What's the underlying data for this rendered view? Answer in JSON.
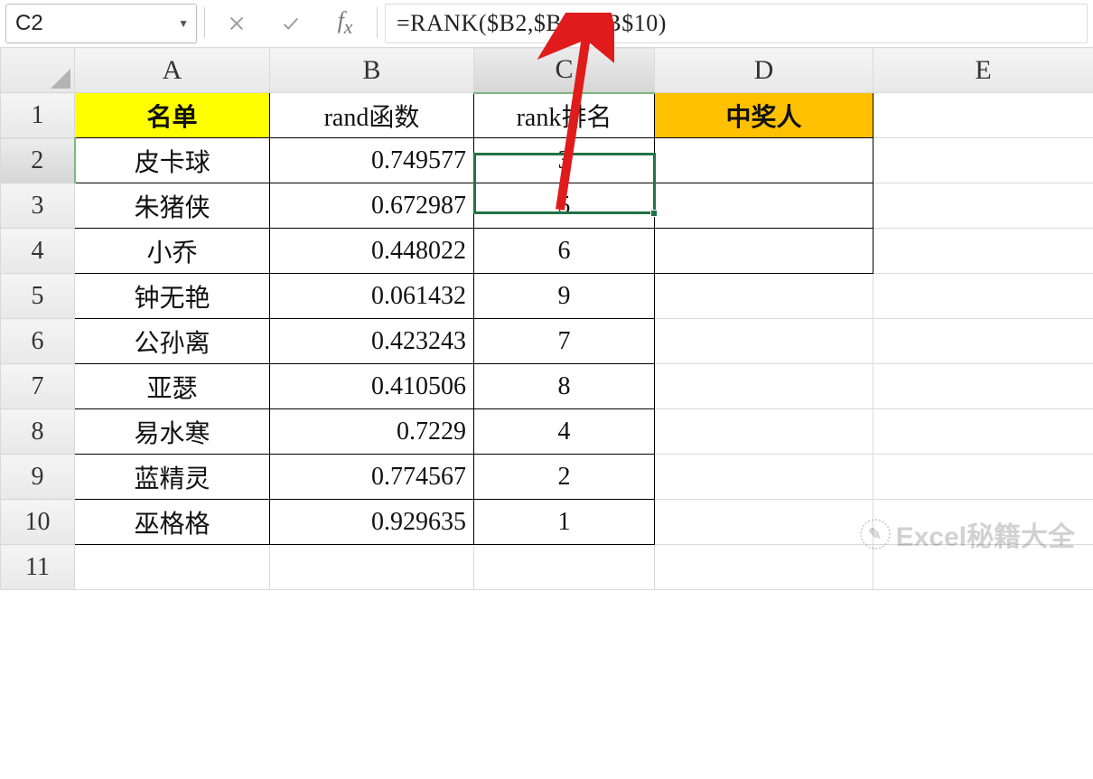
{
  "name_box": "C2",
  "formula": "=RANK($B2,$B$2:$B$10)",
  "columns": [
    "A",
    "B",
    "C",
    "D",
    "E"
  ],
  "row_numbers": [
    1,
    2,
    3,
    4,
    5,
    6,
    7,
    8,
    9,
    10,
    11
  ],
  "selected_col_index": 2,
  "selected_row_index": 1,
  "headers": {
    "A": "名单",
    "B": "rand函数",
    "C": "rank排名",
    "D": "中奖人"
  },
  "data_rows": [
    {
      "name": "皮卡球",
      "rand": "0.749577",
      "rank": "3"
    },
    {
      "name": "朱猪侠",
      "rand": "0.672987",
      "rank": "5"
    },
    {
      "name": "小乔",
      "rand": "0.448022",
      "rank": "6"
    },
    {
      "name": "钟无艳",
      "rand": "0.061432",
      "rank": "9"
    },
    {
      "name": "公孙离",
      "rand": "0.423243",
      "rank": "7"
    },
    {
      "name": "亚瑟",
      "rand": "0.410506",
      "rank": "8"
    },
    {
      "name": "易水寒",
      "rand": "0.7229",
      "rank": "4"
    },
    {
      "name": "蓝精灵",
      "rand": "0.774567",
      "rank": "2"
    },
    {
      "name": "巫格格",
      "rand": "0.929635",
      "rank": "1"
    }
  ],
  "d_boxed_rows": 3,
  "watermark_text": "Excel秘籍大全"
}
